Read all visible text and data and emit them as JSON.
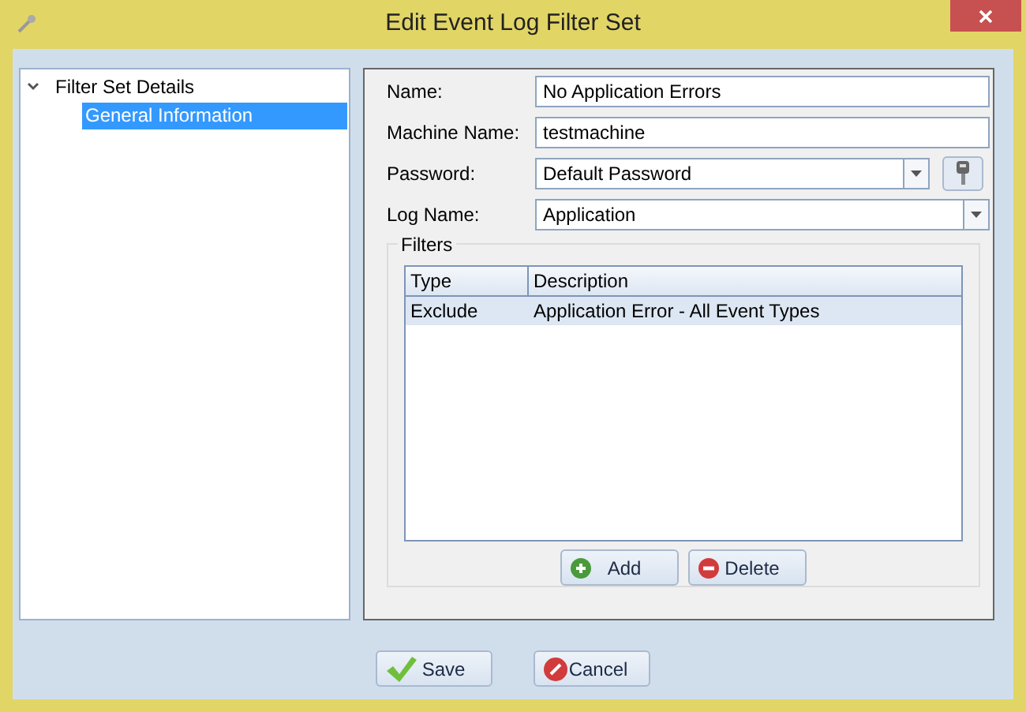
{
  "window": {
    "title": "Edit Event Log Filter Set"
  },
  "tree": [
    {
      "label": "Filter Set Details",
      "expanded": true,
      "selected": false,
      "children": [
        {
          "label": "General Information",
          "selected": true
        }
      ]
    }
  ],
  "form": [
    {
      "kind": "text",
      "label": "Name:",
      "value": "No Application Errors"
    },
    {
      "kind": "text",
      "label": "Machine Name:",
      "value": "testmachine"
    },
    {
      "kind": "combo-key",
      "label": "Password:",
      "value": "Default Password"
    },
    {
      "kind": "combo",
      "label": "Log Name:",
      "value": "Application"
    }
  ],
  "filters": {
    "title": "Filters",
    "columns": [
      "Type",
      "Description"
    ],
    "rows": [
      {
        "cells": [
          "Exclude",
          "Application Error - All Event Types"
        ],
        "selected": true
      }
    ],
    "buttons": [
      {
        "kind": "add",
        "label": "Add"
      },
      {
        "kind": "delete",
        "label": "Delete"
      }
    ]
  },
  "buttons": [
    {
      "kind": "save",
      "label": "Save"
    },
    {
      "kind": "cancel",
      "label": "Cancel"
    }
  ]
}
